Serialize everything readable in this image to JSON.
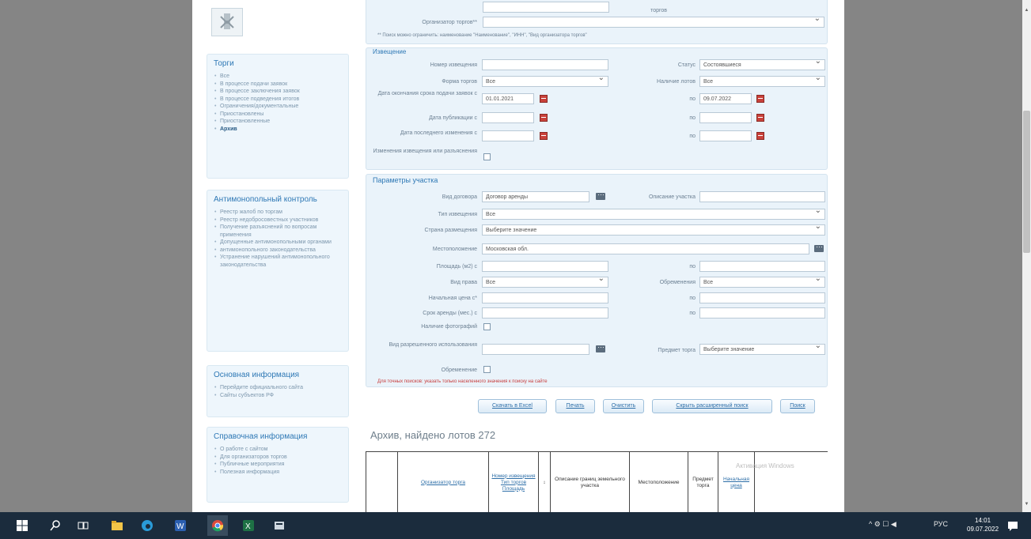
{
  "colors": {
    "accent": "#2e78b5",
    "calendar": "#c9413a",
    "taskbar": "#1b2c3d"
  },
  "sidebar": {
    "logo_icon": "coat-of-arms-icon",
    "torgi": {
      "title": "Торги",
      "items": [
        "Все",
        "В процессе подачи заявок",
        "В процессе заключения заявок",
        "В процессе подведения итогов",
        "Ограничения/документальные",
        "Приостановлены",
        "Приостановленные",
        "Архив"
      ]
    },
    "antimonopoly": {
      "title": "Антимонопольный контроль",
      "items": [
        "Реестр жалоб по торгам",
        "Реестр недобросовестных участников",
        "Получение разъяснений по вопросам применения",
        "Допущенные антимонопольными органами",
        "антимонопольного законодательства",
        "Устранение нарушений антимонопольного законодательства"
      ]
    },
    "basic": {
      "title": "Основная информация",
      "items": [
        "Перейдите официального сайта",
        "Сайты субъектов РФ"
      ]
    },
    "service": {
      "title": "Справочная информация",
      "items": [
        "О работе с сайтом",
        "Для организаторов торгов",
        "Публичные мероприятия",
        "Полезная информация"
      ]
    }
  },
  "top_form": {
    "organizer_label": "Организатор торгов**",
    "hint": "** Поиск можно ограничить: наименование \"Наименование\", \"ИНН\", \"Вид организатора торгов\"",
    "top_right_label": "торгов"
  },
  "notices": {
    "legend": "Извещение",
    "number_label": "Номер извещения",
    "status_label": "Статус",
    "status_value": "Состоявшиеся",
    "form_label": "Форма торгов",
    "form_value": "Все",
    "method_label": "Наличие лотов",
    "method_value": "Все",
    "deadline_label": "Дата окончания срока подачи заявок с",
    "deadline_from": "01.01.2021",
    "to_label": "по",
    "deadline_to": "09.07.2022",
    "pub_label": "Дата публикации с",
    "change_label": "Дата последнего изменения с",
    "changes_label": "Изменения извещения или разъяснения"
  },
  "lot_params": {
    "legend": "Параметры участка",
    "contract_label": "Вид договора",
    "contract_value": "Договор аренды",
    "description_label": "Описание участка",
    "type_label": "Тип извещения",
    "type_value": "Все",
    "country_label": "Страна размещения",
    "country_value": "Выберите значение",
    "location_label": "Местоположение",
    "location_value": "Московская обл.",
    "area_label": "Площадь (м2) с",
    "area_to_label": "по",
    "section_label": "Вид права",
    "section_value": "Все",
    "encumbrance_label": "Обременения",
    "encumbrance_value": "Все",
    "price_label": "Начальная цена с*",
    "price_to_label": "по",
    "rent_label": "Срок аренды (мес.) с",
    "rent_to_label": "по",
    "photo_label": "Наличие фотографий",
    "purpose_label": "Вид разрешенного использования",
    "subject_label": "Предмет торга",
    "subject_value": "Выберите значение",
    "encumb_flag_label": "Обременение",
    "required_note": "Для точных поисков: указать только населенного значения к поиску на сайте"
  },
  "buttons": {
    "export": "Скачать в Excel",
    "print": "Печать",
    "clear": "Очистить",
    "hide": "Скрыть расширенный поиск",
    "search": "Поиск"
  },
  "results": {
    "title": "Архив, найдено лотов 272",
    "columns": [
      "Организатор торга",
      "Номер извещения Тип торгов Площадь",
      "Описание границ земельного участка",
      "Местоположение",
      "Предмет торга",
      "Начальная цена"
    ]
  },
  "watermark": "Активация Windows",
  "taskbar": {
    "lang": "РУС",
    "time": "14:01",
    "date": "09.07.2022"
  }
}
